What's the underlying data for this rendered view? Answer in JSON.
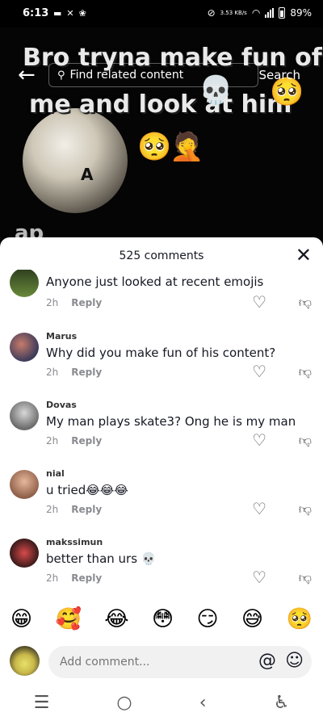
{
  "status_bar": {
    "time": "6:13",
    "battery": "89%",
    "net_speed": "3.53 KB/s"
  },
  "video": {
    "caption_line1": "Bro tryna make fun of",
    "caption_line2": "me and look at him",
    "caption_line3": "ap",
    "overlay_letter": "A",
    "emojis": [
      "skull",
      "shy-face",
      "facepalm",
      "shy-face"
    ]
  },
  "search": {
    "placeholder": "Find related content",
    "button": "Search"
  },
  "comments": {
    "count_label": "525 comments",
    "items": [
      {
        "username": "",
        "text": "Anyone just looked at recent emojis",
        "time": "2h",
        "reply": "Reply"
      },
      {
        "username": "Marus",
        "text": "Why did you make fun of his content?",
        "time": "2h",
        "reply": "Reply"
      },
      {
        "username": "Dovas",
        "text": "My man plays skate3? Ong he is my man",
        "time": "2h",
        "reply": "Reply"
      },
      {
        "username": "nial",
        "text": "u tried😂😂😂",
        "time": "2h",
        "reply": "Reply"
      },
      {
        "username": "makssimun",
        "text": "better than urs 💀",
        "time": "2h",
        "reply": "Reply"
      }
    ]
  },
  "emoji_bar": [
    "😁",
    "🥰",
    "😂",
    "😳",
    "😏",
    "😅",
    "🥺"
  ],
  "input": {
    "placeholder": "Add comment..."
  },
  "colors": {
    "sheet_bg": "#ffffff",
    "video_bg": "#000000",
    "muted_text": "#8a8b91"
  }
}
